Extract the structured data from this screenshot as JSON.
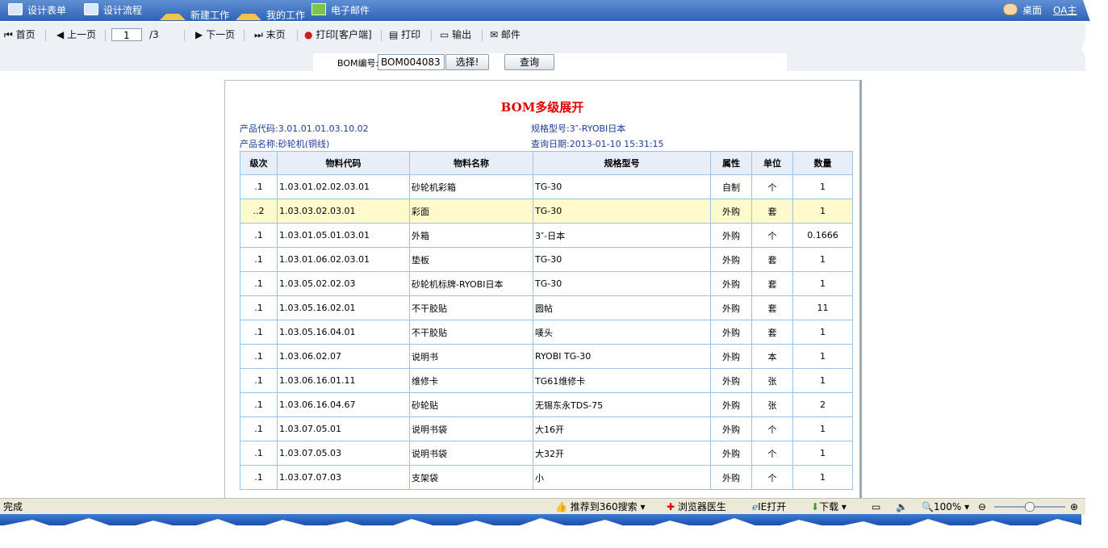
{
  "topbar": {
    "items": [
      {
        "label": "设计表单",
        "icon": "form-icon"
      },
      {
        "label": "设计流程",
        "icon": "flow-icon"
      },
      {
        "label": "新建工作",
        "icon": "new-work-icon"
      },
      {
        "label": "我的工作",
        "icon": "my-work-icon"
      },
      {
        "label": "电子邮件",
        "icon": "mail-icon"
      }
    ],
    "desktop_label": "桌面",
    "oa_label": "OA主"
  },
  "toolbar": {
    "first": "首页",
    "prev": "上一页",
    "page_value": "1",
    "page_total": "/3",
    "next": "下一页",
    "last": "末页",
    "print_client": "打印[客户端]",
    "print": "打印",
    "export": "输出",
    "mail": "邮件"
  },
  "search": {
    "label": "BOM编号:",
    "value": "BOM004083",
    "select_button": "选择!",
    "query_button": "查询"
  },
  "report": {
    "title": "BOM多级展开",
    "product_code": "产品代码:3.01.01.01.03.10.02",
    "spec_model": "规格型号:3″-RYOBI日本",
    "product_name": "产品名称:砂轮机(铜线)",
    "query_date": "查询日期:2013-01-10 15:31:15",
    "columns": [
      "级次",
      "物料代码",
      "物料名称",
      "规格型号",
      "属性",
      "单位",
      "数量"
    ],
    "rows": [
      [
        ".1",
        "1.03.01.02.02.03.01",
        "砂轮机彩箱",
        "TG-30",
        "自制",
        "个",
        "1"
      ],
      [
        "..2",
        "1.03.03.02.03.01",
        "彩面",
        "TG-30",
        "外购",
        "套",
        "1"
      ],
      [
        ".1",
        "1.03.01.05.01.03.01",
        "外箱",
        "3″-日本",
        "外购",
        "个",
        "0.1666"
      ],
      [
        ".1",
        "1.03.01.06.02.03.01",
        "垫板",
        "TG-30",
        "外购",
        "套",
        "1"
      ],
      [
        ".1",
        "1.03.05.02.02.03",
        "砂轮机标牌-RYOBI日本",
        "TG-30",
        "外购",
        "套",
        "1"
      ],
      [
        ".1",
        "1.03.05.16.02.01",
        "不干胶贴",
        "圆帖",
        "外购",
        "套",
        "11"
      ],
      [
        ".1",
        "1.03.05.16.04.01",
        "不干胶贴",
        "唛头",
        "外购",
        "套",
        "1"
      ],
      [
        ".1",
        "1.03.06.02.07",
        "说明书",
        "RYOBI TG-30",
        "外购",
        "本",
        "1"
      ],
      [
        ".1",
        "1.03.06.16.01.11",
        "维修卡",
        "TG61维修卡",
        "外购",
        "张",
        "1"
      ],
      [
        ".1",
        "1.03.06.16.04.67",
        "砂轮贴",
        "无锡东永TDS-75",
        "外购",
        "张",
        "2"
      ],
      [
        ".1",
        "1.03.07.05.01",
        "说明书袋",
        "大16开",
        "外购",
        "个",
        "1"
      ],
      [
        ".1",
        "1.03.07.05.03",
        "说明书袋",
        "大32开",
        "外购",
        "个",
        "1"
      ],
      [
        ".1",
        "1.03.07.07.03",
        "支架袋",
        "小",
        "外购",
        "个",
        "1"
      ]
    ],
    "highlight_row": 1
  },
  "statusbar": {
    "status": "完成",
    "recommend": "推荐到360搜索",
    "doctor": "浏览器医生",
    "ie_open": "IE打开",
    "download": "下载",
    "zoom": "100%"
  }
}
